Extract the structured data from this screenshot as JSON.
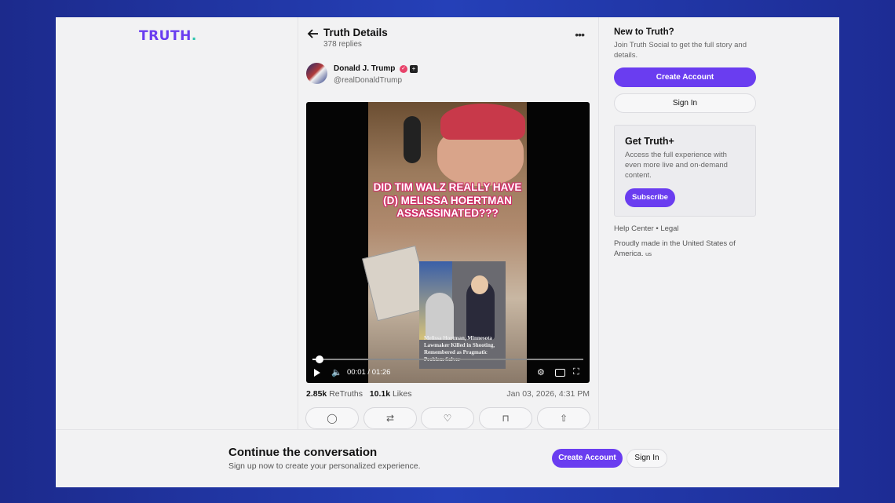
{
  "brand": {
    "logo_text": "TRUTH",
    "logo_dot": ".",
    "accent": "#6a3df0",
    "logo_dot_color": "#2ec6ad"
  },
  "header": {
    "title": "Truth Details",
    "replies": "378 replies",
    "back_icon": "arrow-left-icon",
    "more_icon": "more-horizontal-icon"
  },
  "post": {
    "author_name": "Donald J. Trump",
    "handle": "@realDonaldTrump",
    "video": {
      "overlay_text": "DID TIM WALZ REALLY HAVE (D) MELISSA HOERTMAN ASSASSINATED???",
      "inset_caption": "Melissa Hortman, Minnesota Lawmaker Killed in Shooting, Remembered as Pragmatic Problem Solver",
      "time": "00:01 / 01:26",
      "progress": 0.012
    },
    "retruths_count": "2.85k",
    "retruths_label": "ReTruths",
    "likes_count": "10.1k",
    "likes_label": "Likes",
    "date": "Jan 03, 2026, 4:31 PM"
  },
  "sidebar": {
    "new_title": "New to Truth?",
    "new_sub": "Join Truth Social to get the full story and details.",
    "create_account": "Create Account",
    "sign_in": "Sign In",
    "plus_title": "Get Truth+",
    "plus_desc": "Access the full experience with even more live and on-demand content.",
    "subscribe": "Subscribe",
    "help_center": "Help Center",
    "legal": "Legal",
    "made_in": "Proudly made in the United States of America.",
    "made_in_suffix": "us"
  },
  "bottom": {
    "title": "Continue the conversation",
    "subtitle": "Sign up now to create your personalized experience.",
    "create_account": "Create Account",
    "sign_in": "Sign In"
  }
}
